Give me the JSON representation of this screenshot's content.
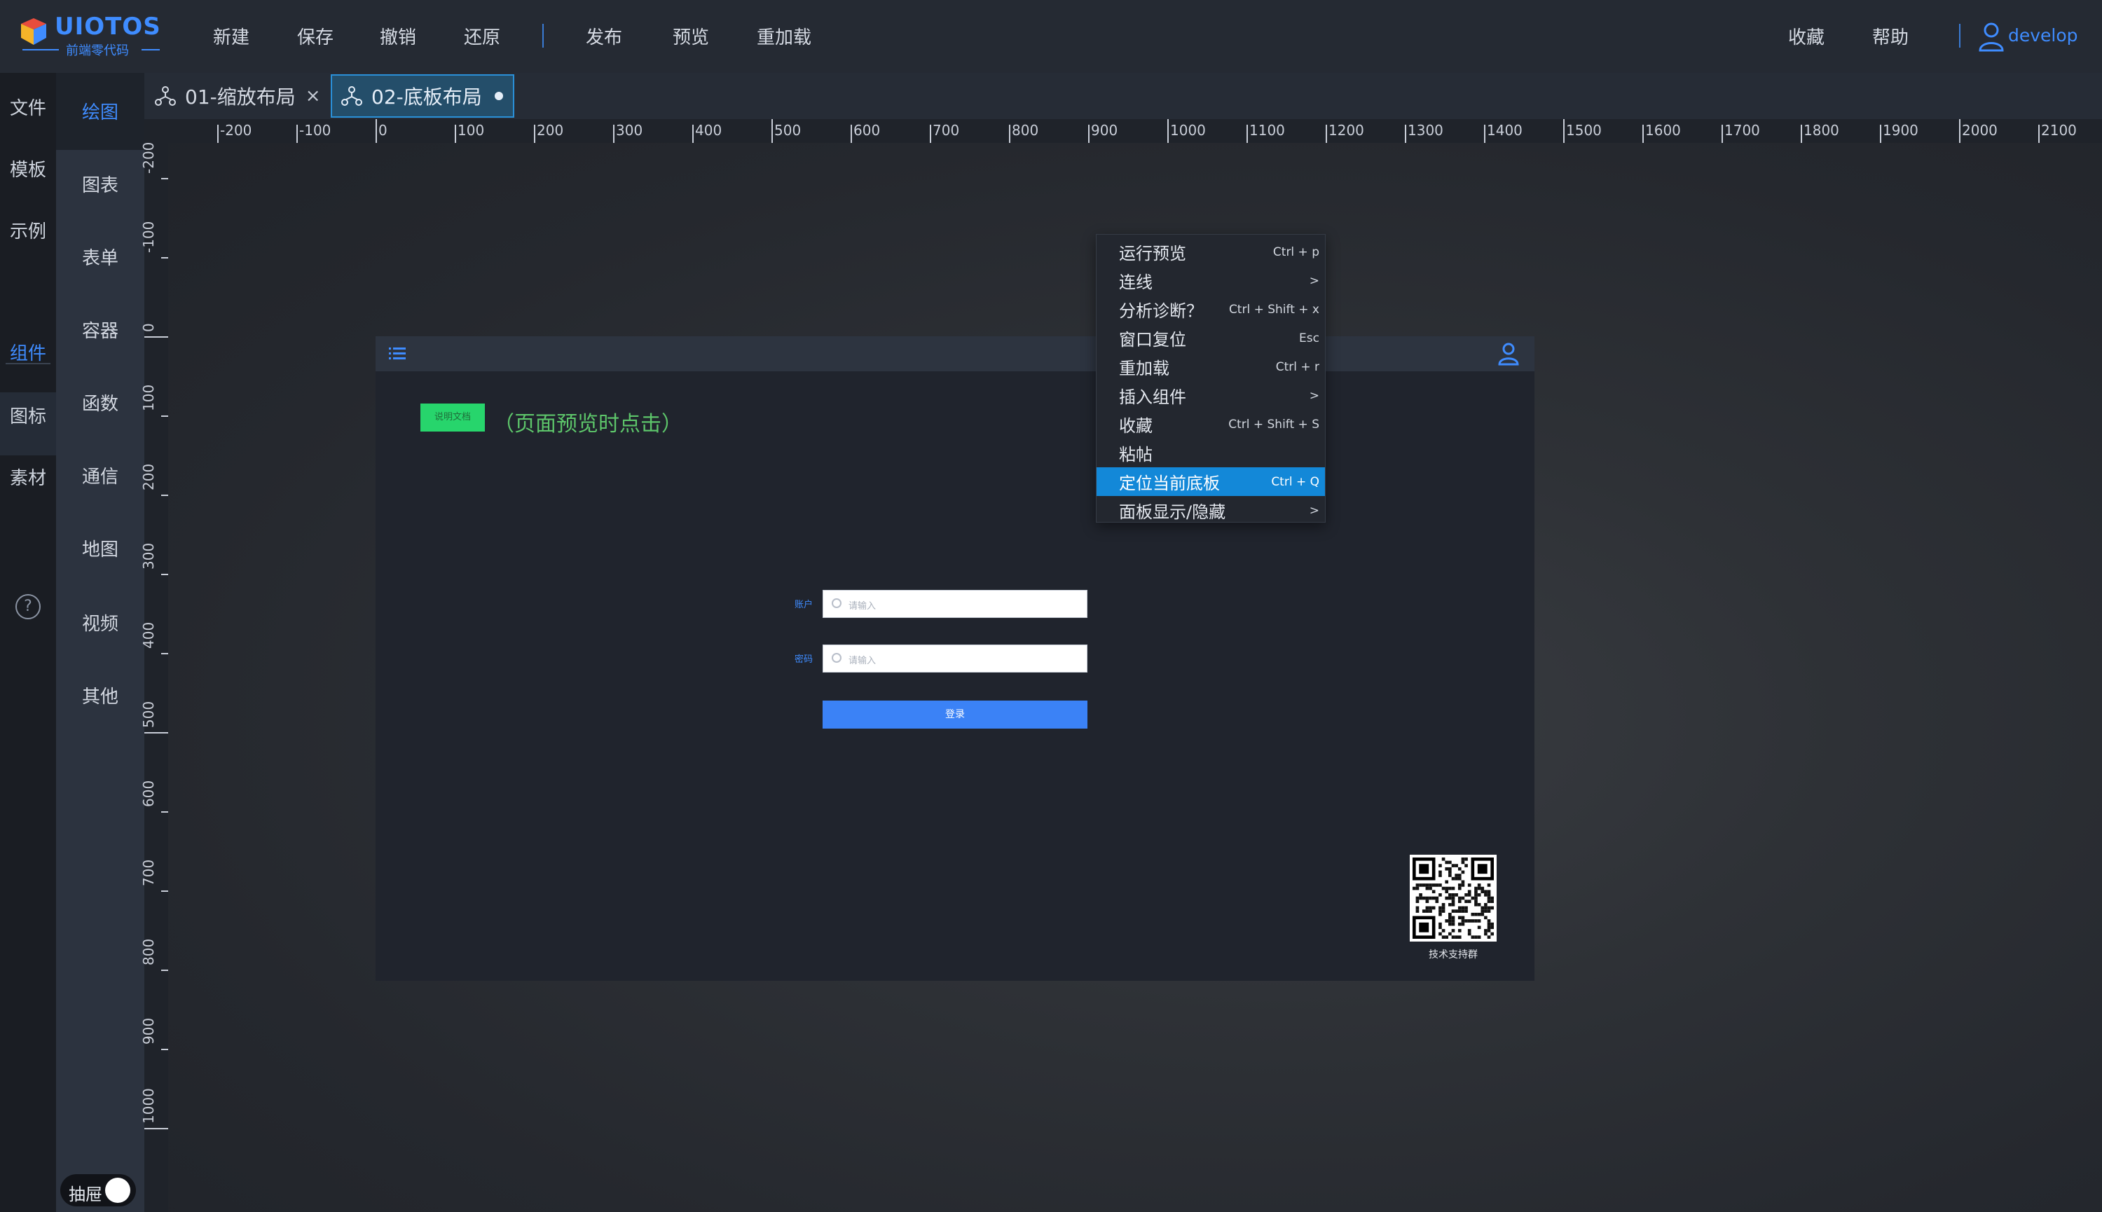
{
  "app": {
    "logo_title": "UIOTOS",
    "logo_subtitle": "前端零代码",
    "brand_color": "#3f8cff"
  },
  "toolbar": {
    "new": "新建",
    "save": "保存",
    "undo": "撤销",
    "redo": "还原",
    "publish": "发布",
    "preview": "预览",
    "reload": "重加载",
    "favorites": "收藏",
    "help": "帮助",
    "user": "develop"
  },
  "rail_primary": {
    "items": [
      "文件",
      "模板",
      "示例",
      "组件",
      "图标",
      "素材"
    ],
    "active": "组件",
    "help_icon": "?"
  },
  "rail_secondary": {
    "items": [
      "绘图",
      "图表",
      "表单",
      "容器",
      "函数",
      "通信",
      "地图",
      "视频",
      "其他"
    ],
    "active": "绘图"
  },
  "tabs": [
    {
      "label": "01-缩放布局",
      "close": "×",
      "icon": "flow-icon"
    },
    {
      "label": "02-底板布局",
      "icon": "flow-icon",
      "modified": true
    }
  ],
  "ruler": {
    "h_labels": [
      "-200",
      "-100",
      "0",
      "100",
      "200",
      "300",
      "400",
      "500",
      "600",
      "700",
      "800",
      "900",
      "1000",
      "1100",
      "1200",
      "1300",
      "1400",
      "1500",
      "1600",
      "1700",
      "1800",
      "1900",
      "2000",
      "2100"
    ],
    "v_labels": [
      "-200",
      "-100",
      "0",
      "100",
      "200",
      "300",
      "400",
      "500",
      "600",
      "700",
      "800",
      "900",
      "1000"
    ]
  },
  "artboard": {
    "doc_button": "说明文档",
    "doc_hint": "（页面预览时点击）",
    "account_label": "账户",
    "password_label": "密码",
    "input_placeholder": "请输入",
    "login_button": "登录",
    "qr_caption": "技术支持群"
  },
  "context_menu": [
    {
      "label": "运行预览",
      "shortcut": "Ctrl + p"
    },
    {
      "label": "连线",
      "shortcut": ">"
    },
    {
      "label": "分析诊断？",
      "shortcut": "Ctrl + Shift + x"
    },
    {
      "label": "窗口复位",
      "shortcut": "Esc"
    },
    {
      "label": "重加载",
      "shortcut": "Ctrl + r"
    },
    {
      "label": "插入组件",
      "shortcut": ">"
    },
    {
      "label": "收藏",
      "shortcut": "Ctrl + Shift + S"
    },
    {
      "label": "粘帖",
      "shortcut": ""
    },
    {
      "label": "定位当前底板",
      "shortcut": "Ctrl + Q",
      "active": true
    },
    {
      "label": "面板显示/隐藏",
      "shortcut": ">"
    }
  ],
  "drawer": {
    "label": "抽屉",
    "on": true
  }
}
